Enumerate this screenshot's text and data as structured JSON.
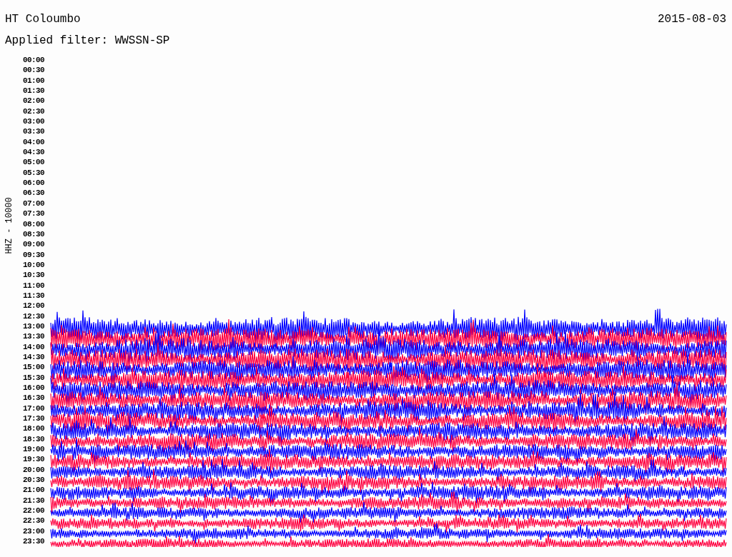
{
  "header": {
    "station": "HT Coloumbo",
    "date": "2015-08-03",
    "filter": "Applied filter: WWSSN-SP"
  },
  "plot": {
    "channel_label": "HHZ - 10000",
    "rows": [
      {
        "time": "00:00"
      },
      {
        "time": "00:30"
      },
      {
        "time": "01:00"
      },
      {
        "time": "01:30"
      },
      {
        "time": "02:00"
      },
      {
        "time": "02:30"
      },
      {
        "time": "03:00"
      },
      {
        "time": "03:30"
      },
      {
        "time": "04:00"
      },
      {
        "time": "04:30"
      },
      {
        "time": "05:00"
      },
      {
        "time": "05:30"
      },
      {
        "time": "06:00"
      },
      {
        "time": "06:30"
      },
      {
        "time": "07:00"
      },
      {
        "time": "07:30"
      },
      {
        "time": "08:00"
      },
      {
        "time": "08:30"
      },
      {
        "time": "09:00"
      },
      {
        "time": "09:30"
      },
      {
        "time": "10:00"
      },
      {
        "time": "10:30"
      },
      {
        "time": "11:00"
      },
      {
        "time": "11:30"
      },
      {
        "time": "12:00"
      },
      {
        "time": "12:30"
      },
      {
        "time": "13:00",
        "color": "#0000ff"
      },
      {
        "time": "13:30",
        "color": "#ff0040"
      },
      {
        "time": "14:00",
        "color": "#0000ff"
      },
      {
        "time": "14:30",
        "color": "#ff0040"
      },
      {
        "time": "15:00",
        "color": "#0000ff"
      },
      {
        "time": "15:30",
        "color": "#ff0040"
      },
      {
        "time": "16:00",
        "color": "#0000ff"
      },
      {
        "time": "16:30",
        "color": "#ff0040"
      },
      {
        "time": "17:00",
        "color": "#0000ff"
      },
      {
        "time": "17:30",
        "color": "#ff0040"
      },
      {
        "time": "18:00",
        "color": "#0000ff"
      },
      {
        "time": "18:30",
        "color": "#ff0040"
      },
      {
        "time": "19:00",
        "color": "#0000ff"
      },
      {
        "time": "19:30",
        "color": "#ff0040"
      },
      {
        "time": "20:00",
        "color": "#0000ff"
      },
      {
        "time": "20:30",
        "color": "#ff0040"
      },
      {
        "time": "21:00",
        "color": "#0000ff"
      },
      {
        "time": "21:30",
        "color": "#ff0040"
      },
      {
        "time": "22:00",
        "color": "#0000ff"
      },
      {
        "time": "22:30",
        "color": "#ff0040"
      },
      {
        "time": "23:00",
        "color": "#0000ff"
      },
      {
        "time": "23:30",
        "color": "#ff0040"
      }
    ]
  }
}
